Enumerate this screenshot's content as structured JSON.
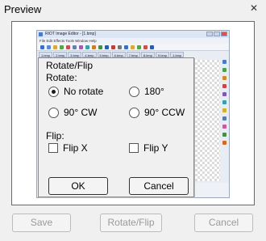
{
  "window": {
    "title": "Preview",
    "close_glyph": "✕"
  },
  "preview_image": {
    "editor_title": "RIOT Image Editor - [1.bmp]",
    "menu": "File   Edit   Effects   Tools   Window   Help",
    "tabs": [
      "1.bmp",
      "2.bmp",
      "3.bmp",
      "4.bmp",
      "5.bmp",
      "6.bmp",
      "7.bmp",
      "8.bmp",
      "9.bmp",
      "1.bmp"
    ],
    "status": "265 x 265        100%",
    "toolbar_colors": [
      "#3a6fc2",
      "#5a8bd6",
      "#d8a93c",
      "#5aa14d",
      "#c75050",
      "#6a7fa8",
      "#9c5fb5",
      "#3a9fb0",
      "#d07a2e",
      "#4d8a4d",
      "#2f5aa8",
      "#b84040",
      "#777777",
      "#3a6fc2",
      "#d8a93c",
      "#5aa14d",
      "#c75050",
      "#2f5aa8"
    ],
    "right_tool_colors": [
      "#4a7ac8",
      "#4aa04a",
      "#d08a2c",
      "#c04848",
      "#7a5ab5",
      "#3a9fb0",
      "#d0b030",
      "#5a7aa8",
      "#c85a9a",
      "#4a8a4a",
      "#d06a2a"
    ],
    "palette": [
      "#000000",
      "#808080",
      "#800000",
      "#808000",
      "#008000",
      "#008080",
      "#000080",
      "#800080",
      "#808040",
      "#004040",
      "#0080ff",
      "#004080",
      "#8000ff",
      "#804000",
      "#ffffff",
      "#c0c0c0",
      "#ff0000",
      "#ffff00",
      "#00ff00",
      "#00ffff",
      "#0000ff",
      "#ff00ff",
      "#ffff80",
      "#00ff80",
      "#80ffff",
      "#8080ff",
      "#ff0080",
      "#ff8040"
    ],
    "palette2": [
      "#000000",
      "#000000",
      "#000000",
      "#000000",
      "#000000",
      "#000000",
      "#000000",
      "#ffffff",
      "#ffffff",
      "#ffffff",
      "#ffffff",
      "#ffffff",
      "#ffffff",
      "#ffffff"
    ]
  },
  "dialog": {
    "title": "Rotate/Flip",
    "rotate_label": "Rotate:",
    "rotate_options": [
      {
        "label": "No rotate",
        "selected": true
      },
      {
        "label": "180°",
        "selected": false
      },
      {
        "label": "90° CW",
        "selected": false
      },
      {
        "label": "90° CCW",
        "selected": false
      }
    ],
    "flip_label": "Flip:",
    "flip_options": [
      {
        "label": "Flip X",
        "checked": false
      },
      {
        "label": "Flip Y",
        "checked": false
      }
    ],
    "ok_label": "OK",
    "cancel_label": "Cancel"
  },
  "footer": {
    "save_label": "Save",
    "rotate_flip_label": "Rotate/Flip",
    "cancel_label": "Cancel"
  }
}
